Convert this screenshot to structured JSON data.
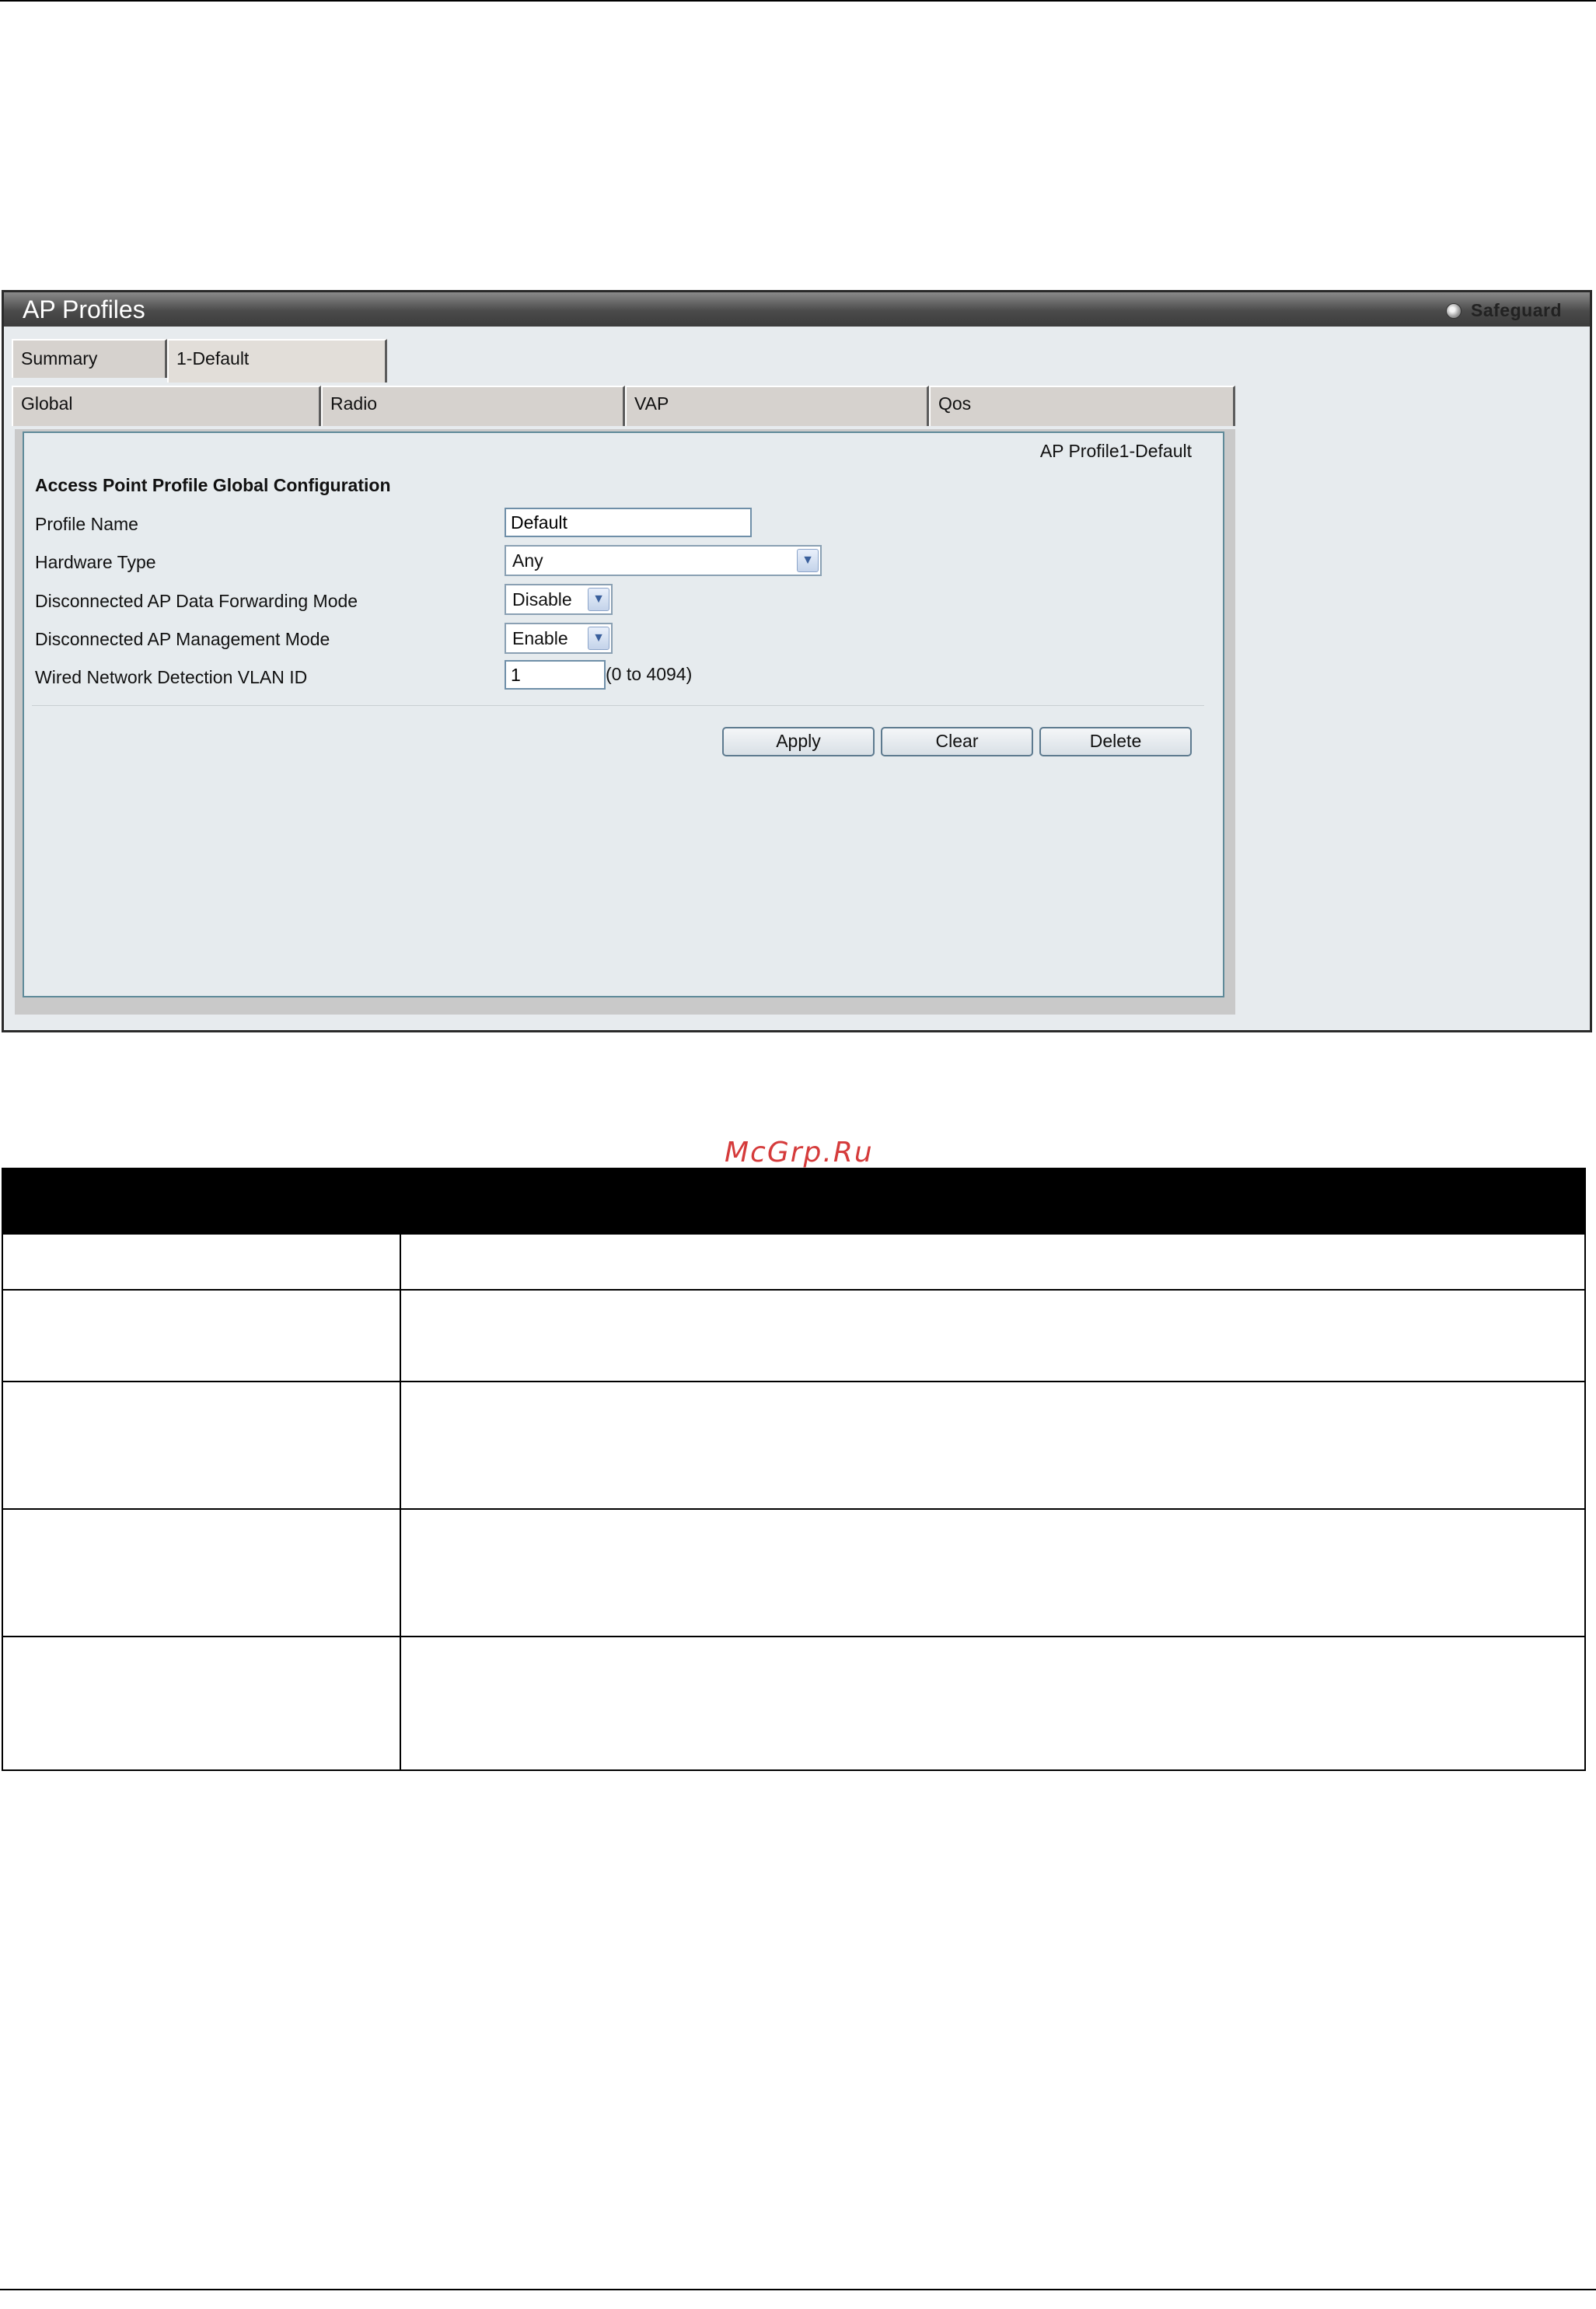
{
  "window": {
    "title": "AP Profiles",
    "safeguard_label": "Safeguard"
  },
  "tabs": [
    {
      "label": "Summary",
      "active": false
    },
    {
      "label": "1-Default",
      "active": true
    }
  ],
  "subtabs": [
    {
      "label": "Global",
      "active": true
    },
    {
      "label": "Radio",
      "active": false
    },
    {
      "label": "VAP",
      "active": false
    },
    {
      "label": "Qos",
      "active": false
    }
  ],
  "form": {
    "profile_label": "AP Profile1-Default",
    "heading": "Access Point Profile Global Configuration",
    "fields": {
      "profile_name": {
        "label": "Profile Name",
        "value": "Default"
      },
      "hardware_type": {
        "label": "Hardware Type",
        "value": "Any"
      },
      "data_forwarding": {
        "label": "Disconnected AP Data Forwarding Mode",
        "value": "Disable"
      },
      "management_mode": {
        "label": "Disconnected AP Management Mode",
        "value": "Enable"
      },
      "vlan_id": {
        "label": "Wired Network Detection VLAN ID",
        "value": "1",
        "hint": "(0 to 4094)"
      }
    },
    "buttons": {
      "apply": "Apply",
      "clear": "Clear",
      "delete": "Delete"
    }
  },
  "watermark": "McGrp.Ru"
}
